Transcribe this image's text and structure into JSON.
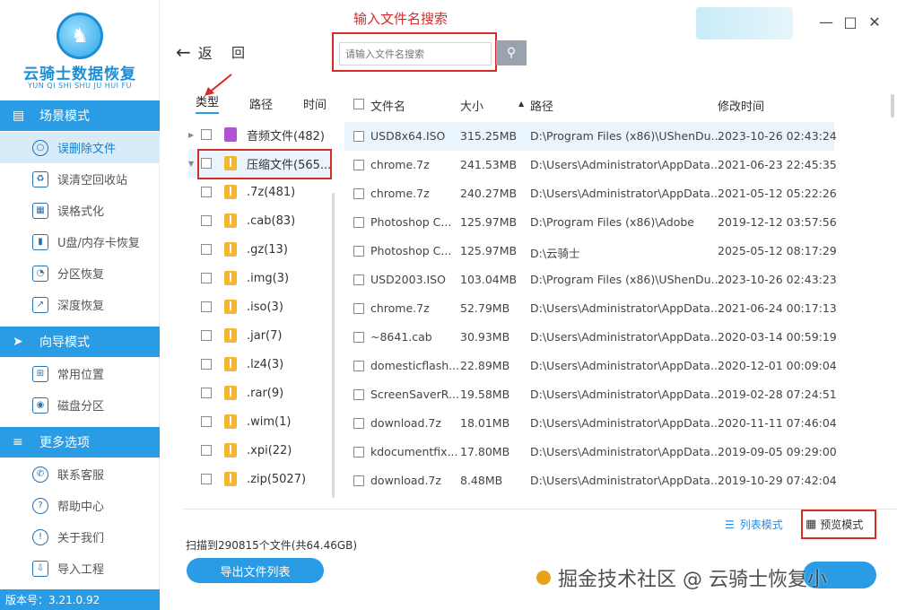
{
  "app": {
    "logo_name": "云骑士数据恢复",
    "logo_sub": "YUN QI SHI SHU JU HUI FU"
  },
  "sidebar": {
    "sections": [
      {
        "title": "场景模式",
        "items": [
          "误删除文件",
          "误清空回收站",
          "误格式化",
          "U盘/内存卡恢复",
          "分区恢复",
          "深度恢复"
        ]
      },
      {
        "title": "向导模式",
        "items": [
          "常用位置",
          "磁盘分区"
        ]
      },
      {
        "title": "更多选项",
        "items": [
          "联系客服",
          "帮助中心",
          "关于我们",
          "导入工程"
        ]
      }
    ],
    "version": "版本号：3.21.0.92"
  },
  "topbar": {
    "back_label": "返",
    "return_label": "回",
    "search_placeholder": "请输入文件名搜索"
  },
  "annotations": {
    "search_hint": "输入文件名搜索"
  },
  "tree": {
    "tabs": [
      "类型",
      "路径",
      "时间"
    ],
    "items": [
      {
        "label": "音频文件(482)",
        "icon": "audio-icon",
        "expand": "right"
      },
      {
        "label": "压缩文件(565...",
        "icon": "zip-icon",
        "expand": "down",
        "selected": true
      },
      {
        "label": ".7z(481)",
        "icon": "zip-icon"
      },
      {
        "label": ".cab(83)",
        "icon": "zip-icon"
      },
      {
        "label": ".gz(13)",
        "icon": "zip-icon"
      },
      {
        "label": ".img(3)",
        "icon": "zip-icon"
      },
      {
        "label": ".iso(3)",
        "icon": "zip-icon"
      },
      {
        "label": ".jar(7)",
        "icon": "zip-icon"
      },
      {
        "label": ".lz4(3)",
        "icon": "zip-icon"
      },
      {
        "label": ".rar(9)",
        "icon": "zip-icon"
      },
      {
        "label": ".wim(1)",
        "icon": "zip-icon"
      },
      {
        "label": ".xpi(22)",
        "icon": "zip-icon"
      },
      {
        "label": ".zip(5027)",
        "icon": "zip-icon"
      }
    ]
  },
  "table": {
    "columns": [
      "文件名",
      "大小",
      "路径",
      "修改时间"
    ],
    "rows": [
      {
        "name": "USD8x64.ISO",
        "size": "315.25MB",
        "path": "D:\\Program Files (x86)\\UShenDu...",
        "modified": "2023-10-26 02:43:24"
      },
      {
        "name": "chrome.7z",
        "size": "241.53MB",
        "path": "D:\\Users\\Administrator\\AppData...",
        "modified": "2021-06-23 22:45:35"
      },
      {
        "name": "chrome.7z",
        "size": "240.27MB",
        "path": "D:\\Users\\Administrator\\AppData...",
        "modified": "2021-05-12 05:22:26"
      },
      {
        "name": "Photoshop C...",
        "size": "125.97MB",
        "path": "D:\\Program Files (x86)\\Adobe",
        "modified": "2019-12-12 03:57:56"
      },
      {
        "name": "Photoshop C...",
        "size": "125.97MB",
        "path": "D:\\云骑士",
        "modified": "2025-05-12 08:17:29"
      },
      {
        "name": "USD2003.ISO",
        "size": "103.04MB",
        "path": "D:\\Program Files (x86)\\UShenDu...",
        "modified": "2023-10-26 02:43:23"
      },
      {
        "name": "chrome.7z",
        "size": "52.79MB",
        "path": "D:\\Users\\Administrator\\AppData...",
        "modified": "2021-06-24 00:17:13"
      },
      {
        "name": "~8641.cab",
        "size": "30.93MB",
        "path": "D:\\Users\\Administrator\\AppData...",
        "modified": "2020-03-14 00:59:19"
      },
      {
        "name": "domesticflash...",
        "size": "22.89MB",
        "path": "D:\\Users\\Administrator\\AppData...",
        "modified": "2020-12-01 00:09:04"
      },
      {
        "name": "ScreenSaverR...",
        "size": "19.58MB",
        "path": "D:\\Users\\Administrator\\AppData...",
        "modified": "2019-02-28 07:24:51"
      },
      {
        "name": "download.7z",
        "size": "18.01MB",
        "path": "D:\\Users\\Administrator\\AppData...",
        "modified": "2020-11-11 07:46:04"
      },
      {
        "name": "kdocumentfix...",
        "size": "17.80MB",
        "path": "D:\\Users\\Administrator\\AppData...",
        "modified": "2019-09-05 09:29:00"
      },
      {
        "name": "download.7z",
        "size": "8.48MB",
        "path": "D:\\Users\\Administrator\\AppData...",
        "modified": "2019-10-29 07:42:04"
      }
    ]
  },
  "bottom": {
    "list_mode": "列表模式",
    "preview_mode": "预览模式",
    "scan_info": "扫描到290815个文件(共64.46GB)",
    "export_label": "导出文件列表"
  },
  "watermark": "掘金技术社区 @ 云骑士恢复小"
}
